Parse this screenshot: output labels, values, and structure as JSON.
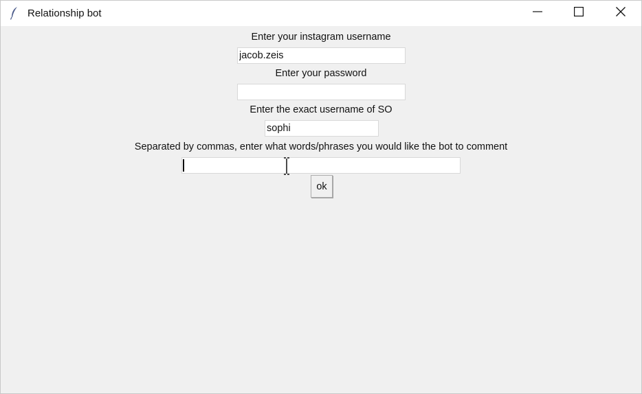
{
  "window": {
    "title": "Relationship bot",
    "icon": "feather-icon",
    "controls": [
      "minimize-icon",
      "maximize-icon",
      "close-icon"
    ]
  },
  "form": {
    "username_label": "Enter your instagram username",
    "username_value": "jacob.zeis",
    "password_label": "Enter your password",
    "password_value": "",
    "so_label": "Enter the exact username of SO",
    "so_value": "sophi",
    "comments_label": "Separated by commas, enter what words/phrases you would like the bot to comment",
    "comments_value": "",
    "ok_label": "ok"
  }
}
